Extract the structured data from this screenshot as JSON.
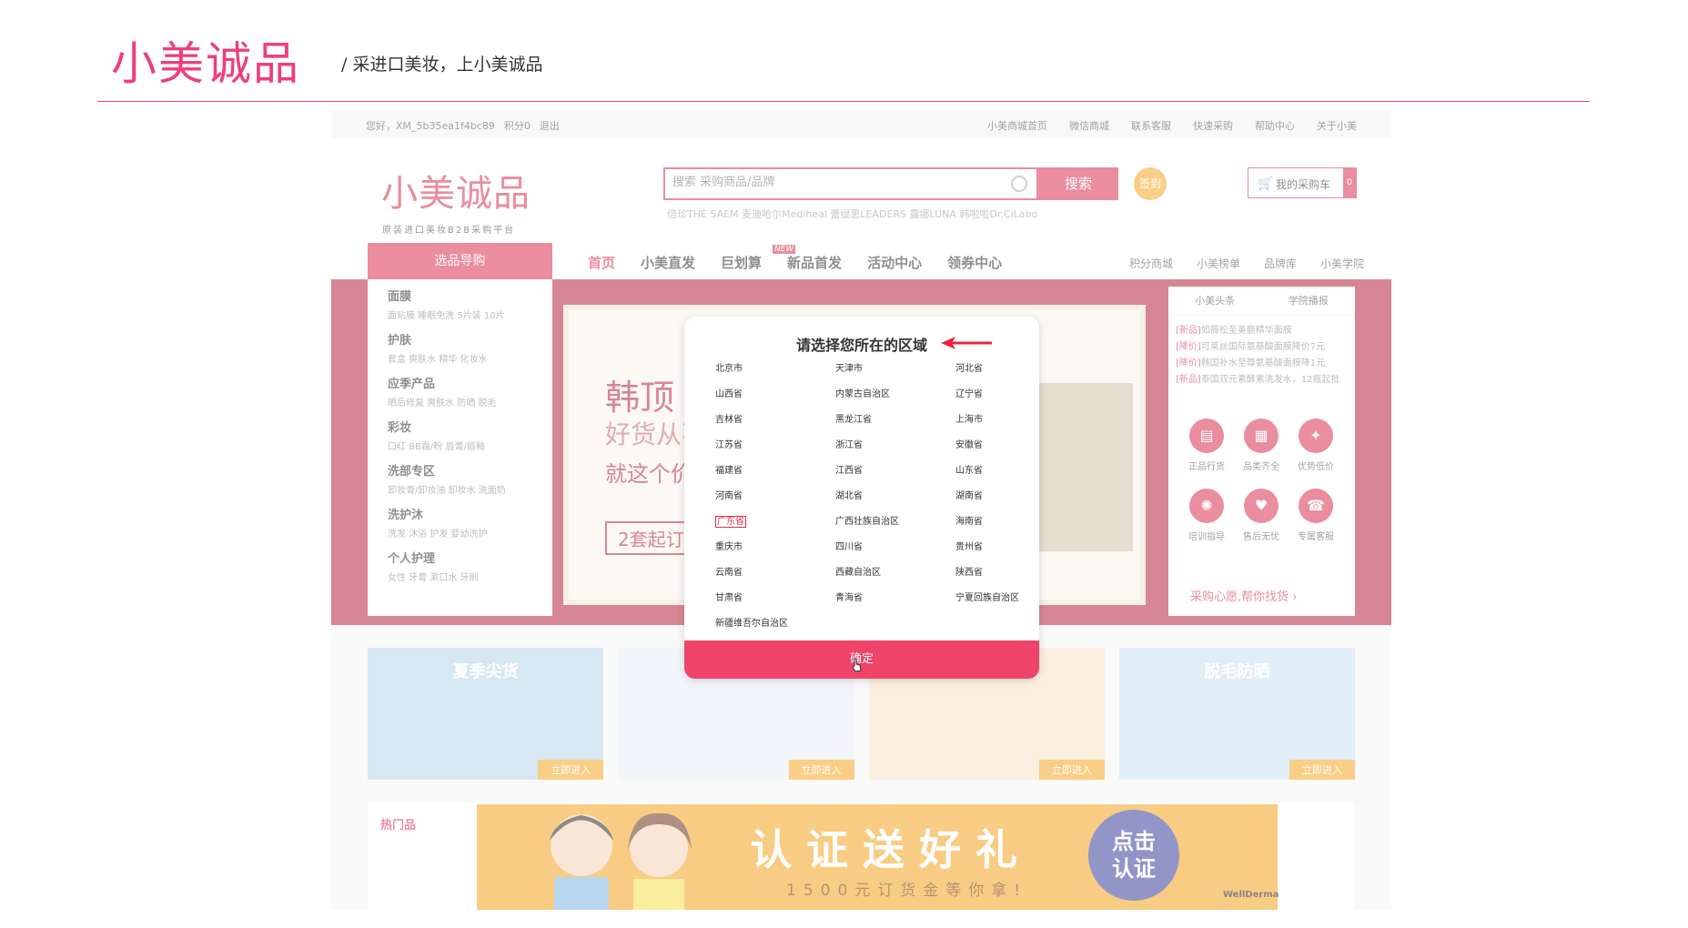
{
  "slide": {
    "logo": "小美诚品",
    "tagline": "/  采进口美妆，上小美诚品"
  },
  "topbar": {
    "greeting": "您好，XM_5b35ea1f4bc89",
    "points": "积分0",
    "logout": "退出",
    "links": [
      "小美商城首页",
      "微信商城",
      "联系客服",
      "快速采购",
      "帮助中心",
      "关于小美"
    ]
  },
  "header": {
    "logo": "小美诚品",
    "logo_sub": "原装进口美妆B2B采购平台",
    "search_placeholder": "搜索 采购商品/品牌",
    "search_button": "搜索",
    "sign_button": "签到",
    "hot_words": "倍珍THE SAEM  麦迪哈尔Mediheal  蕾缇思LEADERS  露娜LUNA  韩啦啦Dr.CiLabo",
    "cart_label": "我的采购车",
    "cart_count": "0"
  },
  "nav": {
    "guide_tab": "选品导购",
    "items": [
      "首页",
      "小美直发",
      "巨划算",
      "新品首发",
      "活动中心",
      "领券中心"
    ],
    "new_badge": "NEW",
    "right_links": [
      "积分商城",
      "小美榜单",
      "品牌库",
      "小美学院"
    ]
  },
  "categories": [
    {
      "title": "面膜",
      "sub": "面贴膜  睡眠免洗  5片装  10片"
    },
    {
      "title": "护肤",
      "sub": "套盒  爽肤水  精华  化妆水"
    },
    {
      "title": "应季产品",
      "sub": "晒后修复  爽肤水  防晒  脱毛"
    },
    {
      "title": "彩妆",
      "sub": "口红  BB霜/粉  唇膏/唇釉"
    },
    {
      "title": "洗部专区",
      "sub": "卸妆膏/卸妆油  卸妆水  洗面奶"
    },
    {
      "title": "洗护沐",
      "sub": "洗发  沐浴  护发  婴幼洗护"
    },
    {
      "title": "个人护理",
      "sub": "女性  牙膏  漱口水  牙刷"
    }
  ],
  "hero": {
    "title": "韩顶",
    "sub1": "好货从不",
    "sub2": "就这个价",
    "tag": "2套起订"
  },
  "news": {
    "tabs": [
      "小美头条",
      "学院播报"
    ],
    "items": [
      {
        "tag": "[新品]",
        "text": "如薇松至美鹿精华面膜"
      },
      {
        "tag": "[降价]",
        "text": "可莱丝国际氨基酸面膜降价7元"
      },
      {
        "tag": "[降价]",
        "text": "韩国补水至尊氨基酸面膜降1元"
      },
      {
        "tag": "[新品]",
        "text": "泰国双元素酵素洗发水，12瓶起批"
      }
    ],
    "services": [
      {
        "icon": "invoice-icon",
        "glyph": "▤",
        "label": "正品行货"
      },
      {
        "icon": "grid-icon",
        "glyph": "▦",
        "label": "品类齐全"
      },
      {
        "icon": "discount-icon",
        "glyph": "✦",
        "label": "优势低价"
      },
      {
        "icon": "bulb-icon",
        "glyph": "✺",
        "label": "培训指导"
      },
      {
        "icon": "heart-icon",
        "glyph": "♥",
        "label": "售后无忧"
      },
      {
        "icon": "headset-icon",
        "glyph": "☎",
        "label": "专属客服"
      }
    ],
    "wish_link": "采购心愿,帮你找货 ›"
  },
  "promos": [
    {
      "title": "夏季尖货",
      "enter": "立即进入"
    },
    {
      "title": "",
      "enter": "立即进入"
    },
    {
      "title": "",
      "enter": "立即进入"
    },
    {
      "title": "脱毛防晒",
      "enter": "立即进入"
    }
  ],
  "hot_label": "热门品",
  "ad": {
    "title": "认证送好礼",
    "sub": "1500元订货金等你拿!",
    "badge_line1": "点击",
    "badge_line2": "认证",
    "brand": "WellDerma"
  },
  "modal": {
    "title": "请选择您所在的区域",
    "regions": [
      "北京市",
      "天津市",
      "河北省",
      "山西省",
      "内蒙古自治区",
      "辽宁省",
      "吉林省",
      "黑龙江省",
      "上海市",
      "江苏省",
      "浙江省",
      "安徽省",
      "福建省",
      "江西省",
      "山东省",
      "河南省",
      "湖北省",
      "湖南省",
      "广东省",
      "广西壮族自治区",
      "海南省",
      "重庆市",
      "四川省",
      "贵州省",
      "云南省",
      "西藏自治区",
      "陕西省",
      "甘肃省",
      "青海省",
      "宁夏回族自治区",
      "新疆维吾尔自治区"
    ],
    "selected_region": "广东省",
    "confirm": "确定"
  },
  "colors": {
    "brand": "#d9304f",
    "slide_accent": "#ee3f79",
    "confirm": "#f0436a"
  }
}
